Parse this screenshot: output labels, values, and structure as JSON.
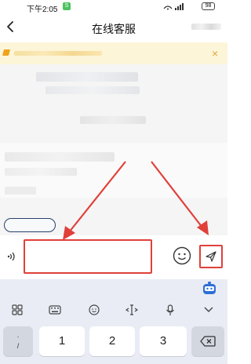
{
  "status_bar": {
    "time": "下午2:05",
    "app_badge": "S",
    "battery": "98"
  },
  "header": {
    "title": "在线客服"
  },
  "notice": {
    "close_glyph": "×"
  },
  "input": {
    "placeholder": "",
    "value": ""
  },
  "keyboard": {
    "sym_label_top": ".",
    "sym_label_bottom": "/",
    "keys": [
      "1",
      "2",
      "3"
    ]
  },
  "colors": {
    "accent_red": "#e0403a",
    "notice_bg": "#fdf5d8",
    "keyboard_bg": "#e9ecf5",
    "pill_border": "#26416d"
  },
  "icons": {
    "back": "chevron-left-icon",
    "wifi": "wifi-icon",
    "voice": "voice-icon",
    "emoji": "emoji-icon",
    "send": "send-icon",
    "delete": "backspace-icon"
  }
}
